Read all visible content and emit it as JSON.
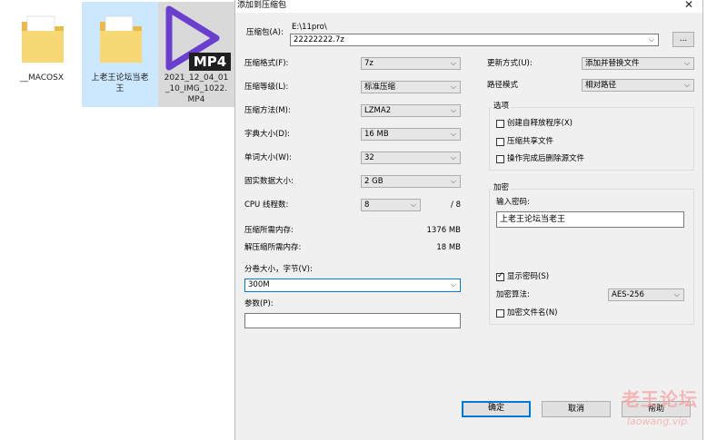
{
  "desktop": {
    "items": [
      {
        "label": "__MACOSX"
      },
      {
        "label": "上老王论坛当老\n王"
      },
      {
        "label": "2021_12_04_01\n_10_IMG_1022.\nMP4",
        "badge": "MP4"
      }
    ]
  },
  "dialog": {
    "title": "添加到压缩包",
    "close_icon": "close-icon",
    "archive_label": "压缩包(A):",
    "archive_path": "E:\\11pro\\",
    "archive_name": "22222222.7z",
    "browse_label": "...",
    "left": {
      "format_label": "压缩格式(F):",
      "format_value": "7z",
      "level_label": "压缩等级(L):",
      "level_value": "标准压缩",
      "method_label": "压缩方法(M):",
      "method_value": "LZMA2",
      "dict_label": "字典大小(D):",
      "dict_value": "16 MB",
      "word_label": "单词大小(W):",
      "word_value": "32",
      "solid_label": "固实数据大小:",
      "solid_value": "2 GB",
      "cpu_label": "CPU 线程数:",
      "cpu_value": "8",
      "cpu_max": "/ 8",
      "mem_comp_label": "压缩所需内存:",
      "mem_comp_value": "1376 MB",
      "mem_decomp_label": "解压缩所需内存:",
      "mem_decomp_value": "18 MB",
      "volume_label": "分卷大小，字节(V):",
      "volume_value": "300M",
      "params_label": "参数(P):",
      "params_value": ""
    },
    "right": {
      "update_label": "更新方式(U):",
      "update_value": "添加并替换文件",
      "path_label": "路径模式",
      "path_value": "相对路径",
      "options_title": "选项",
      "opt_sfx": "创建自释放程序(X)",
      "opt_shared": "压缩共享文件",
      "opt_delete": "操作完成后删除源文件",
      "encrypt_title": "加密",
      "password_label": "输入密码:",
      "password_value": "上老王论坛当老王",
      "show_password": "显示密码(S)",
      "enc_method_label": "加密算法:",
      "enc_method_value": "AES-256",
      "enc_names": "加密文件名(N)"
    },
    "buttons": {
      "ok": "确定",
      "cancel": "取消",
      "help": "帮助"
    }
  },
  "watermark": {
    "cn": "老王论坛",
    "en": "laowang.vip"
  },
  "colors": {
    "accent": "#0078d7",
    "folder": "#f8d775",
    "video_purple": "#6a3fd0"
  }
}
